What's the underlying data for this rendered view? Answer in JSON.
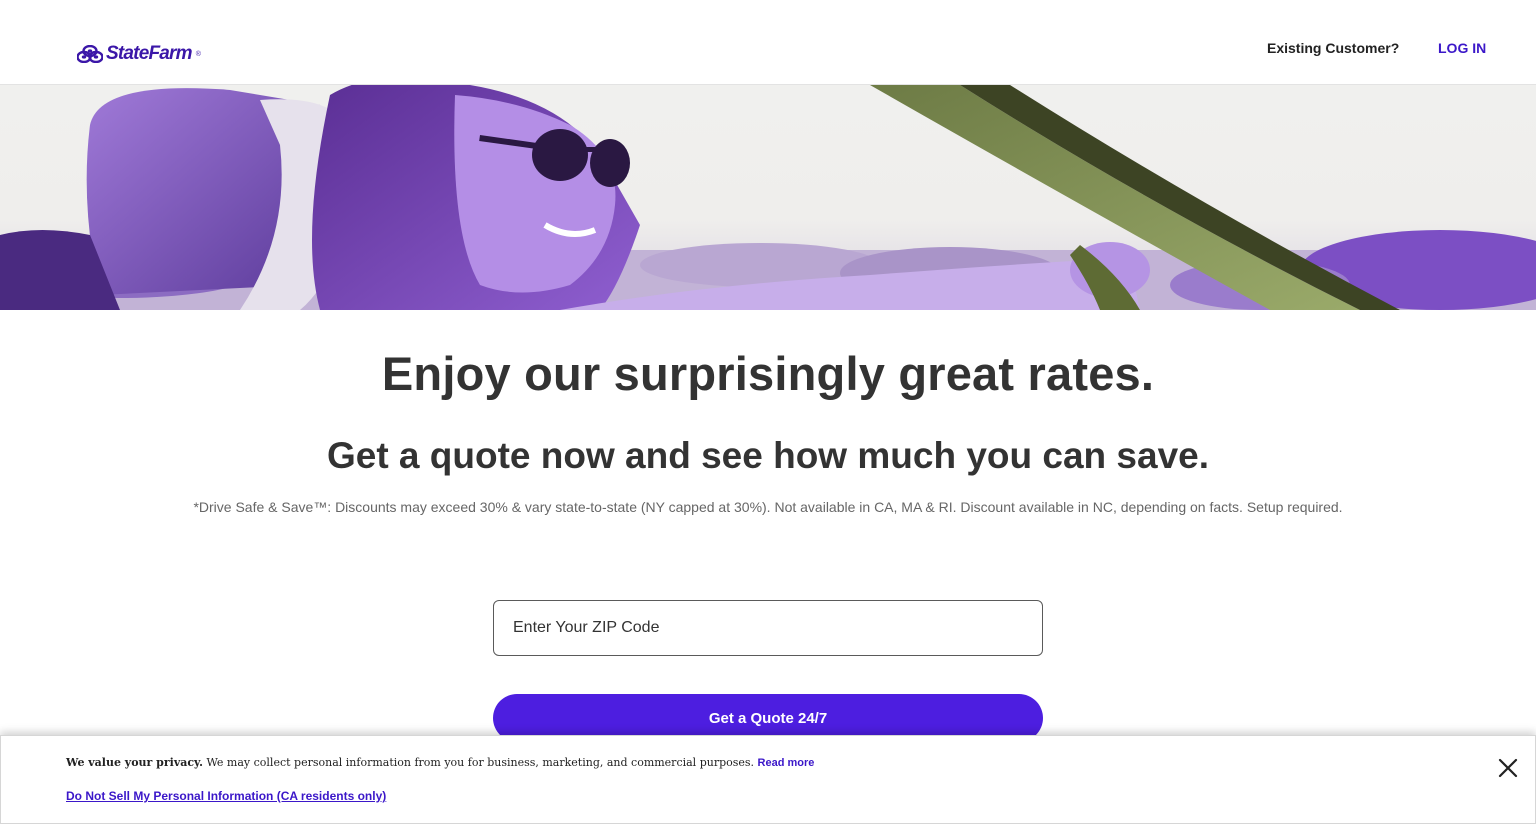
{
  "brand": {
    "logo_text": "StateFarm",
    "logo_tm": "®",
    "brand_color": "#3b17a8"
  },
  "header": {
    "existing_customer": "Existing Customer?",
    "login_label": "LOG IN"
  },
  "hero": {
    "alt": "Smiling woman with sunglasses driving a car",
    "icon": "hero-photo"
  },
  "main": {
    "headline": "Enjoy our surprisingly great rates.",
    "subheadline": "Get a quote now and see how much you can save.",
    "disclaimer": "*Drive Safe & Save™: Discounts may exceed 30% & vary state-to-state (NY capped at 30%). Not available in CA, MA & RI. Discount available in NC, depending on facts. Setup required."
  },
  "form": {
    "zip_placeholder": "Enter Your ZIP Code",
    "zip_value": "",
    "submit_label": "Get a Quote 24/7",
    "button_color": "#4d1ee0"
  },
  "privacy": {
    "lead": "We value your privacy.",
    "body": "We may collect personal information from you for business, marketing, and commercial purposes.",
    "read_more": "Read more",
    "do_not_sell": "Do Not Sell My Personal Information (CA residents only)",
    "close_icon": "close-icon"
  }
}
